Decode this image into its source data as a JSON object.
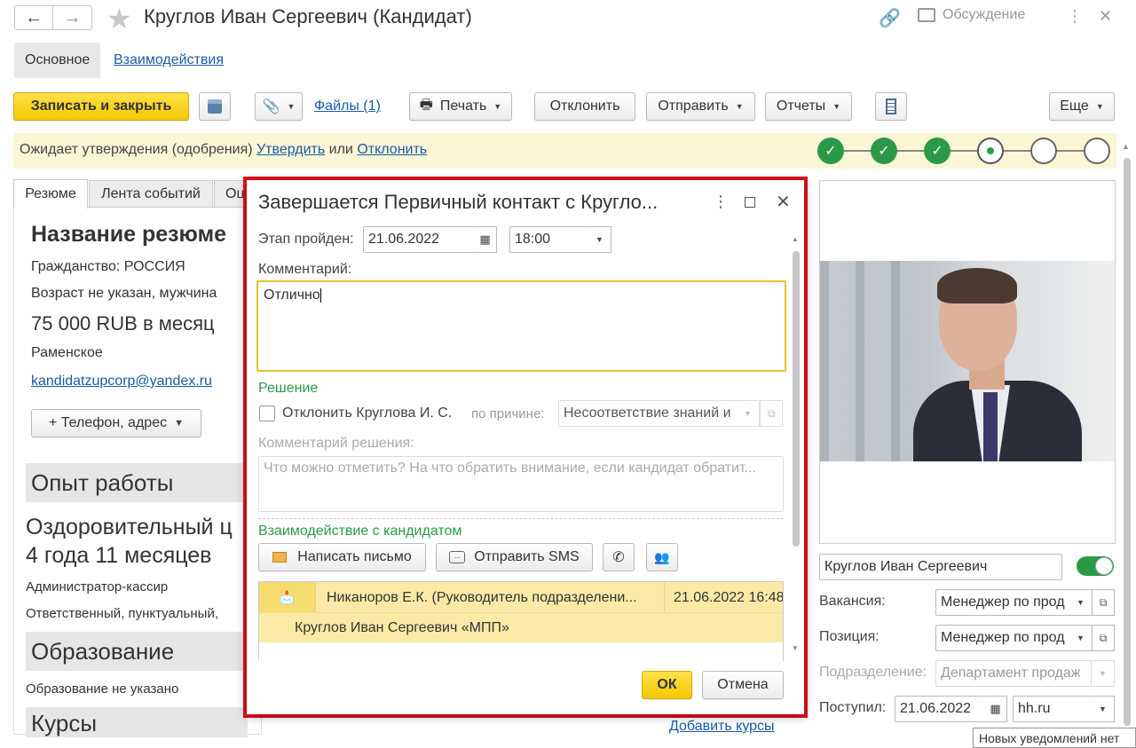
{
  "window": {
    "title": "Круглов Иван Сергеевич (Кандидат)",
    "discussion": "Обсуждение"
  },
  "tabs": [
    "Основное",
    "Взаимодействия"
  ],
  "toolbar": {
    "save_close": "Записать и закрыть",
    "files": "Файлы (1)",
    "print": "Печать",
    "reject": "Отклонить",
    "send": "Отправить",
    "reports": "Отчеты",
    "more": "Еще"
  },
  "approval": {
    "text": "Ожидает утверждения (одобрения)",
    "approve": "Утвердить",
    "or": "или",
    "reject": "Отклонить"
  },
  "steps": [
    "done",
    "done",
    "done",
    "current",
    "todo",
    "todo"
  ],
  "resume": {
    "tabs": [
      "Резюме",
      "Лента событий",
      "Оц"
    ],
    "title": "Название резюме",
    "citizenship": "Гражданство: РОССИЯ",
    "age": "Возраст не указан, мужчина",
    "salary": "75 000 RUB в месяц",
    "city": "Раменское",
    "email": "kandidatzupcorp@yandex.ru",
    "phone_button": "+ Телефон, адрес",
    "experience_header": "Опыт работы",
    "experience_company": "Оздоровительный ц",
    "experience_duration": "4 года 11 месяцев",
    "experience_position": "Администратор-кассир",
    "experience_desc": "Ответственный, пунктуальный,",
    "education_header": "Образование",
    "education_text": "Образование не указано",
    "courses_header": "Курсы",
    "add_courses": "Добавить курсы"
  },
  "dialog": {
    "title": "Завершается Первичный контакт с Кругло...",
    "stage_label": "Этап пройден:",
    "stage_date": "21.06.2022",
    "stage_time": "18:00",
    "comment_label": "Комментарий:",
    "comment_value": "Отлично",
    "decision_header": "Решение",
    "reject_checkbox": "Отклонить Круглова И. С.",
    "reason_label": "по причине:",
    "reason_value": "Несоответствие знаний и",
    "decision_comment_label": "Комментарий решения:",
    "decision_comment_placeholder": "Что можно отметить? На что обратить внимание, если кандидат обратит...",
    "interaction_header": "Взаимодействие с кандидатом",
    "write_letter": "Написать письмо",
    "send_sms": "Отправить SMS",
    "list_row_from": "Никаноров Е.К. (Руководитель подразделени...",
    "list_row_date": "21.06.2022 16:48",
    "list_row_to": "Круглов Иван Сергеевич «МПП»",
    "ok": "ОК",
    "cancel": "Отмена"
  },
  "candidate": {
    "name": "Круглов Иван Сергеевич",
    "vacancy_label": "Вакансия:",
    "vacancy_value": "Менеджер по прод",
    "position_label": "Позиция:",
    "position_value": "Менеджер по прод",
    "department_label": "Подразделение:",
    "department_value": "Департамент продаж",
    "received_label": "Поступил:",
    "received_date": "21.06.2022",
    "received_source": "hh.ru"
  },
  "tooltip": "Новых уведомлений нет",
  "colors": {
    "accent_yellow": "#f4c800",
    "highlight_red": "#e3101b",
    "success_green": "#2b9a47",
    "approval_bg": "#fbf6d6",
    "link_blue": "#1a5ba6"
  }
}
